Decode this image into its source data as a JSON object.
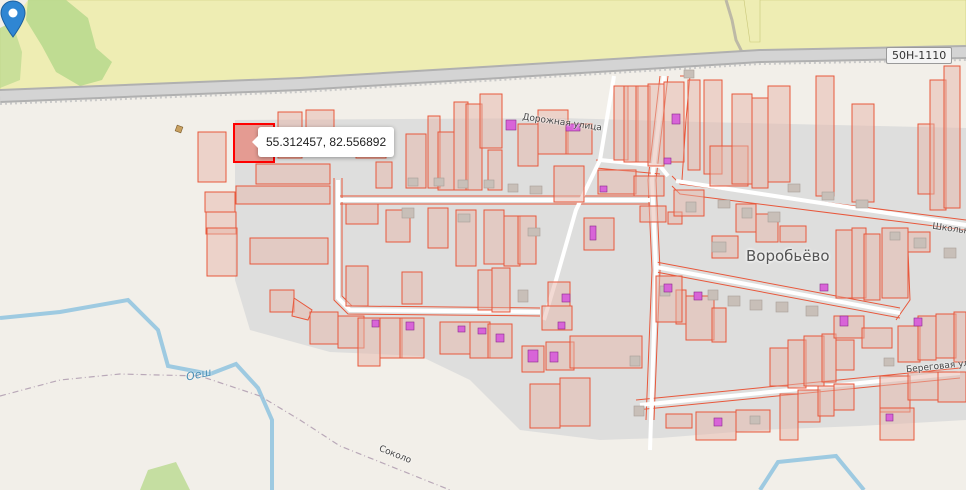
{
  "map": {
    "road_ref": "50Н-1110",
    "village_name": "Воробьёво",
    "streets": {
      "dorozhnaya": "Дорожная улица",
      "shkolnaya": "Школьная",
      "beregovaya": "Береговая ул",
      "sokol": "Соколо"
    },
    "river_name": "Оеш",
    "colors": {
      "land": "#f2efe9",
      "farmland": "#eeedb3",
      "meadow": "#b9d98e",
      "residential": "#dadada",
      "parcel_stroke": "#e8583c",
      "building": "#d9a9e0",
      "water": "#9ecae1",
      "highlight": "#ff0000"
    }
  },
  "popup": {
    "coordinates": "55.312457, 82.556892"
  },
  "marker": {
    "icon": "map-pin-icon",
    "color": "#2f86d3"
  }
}
